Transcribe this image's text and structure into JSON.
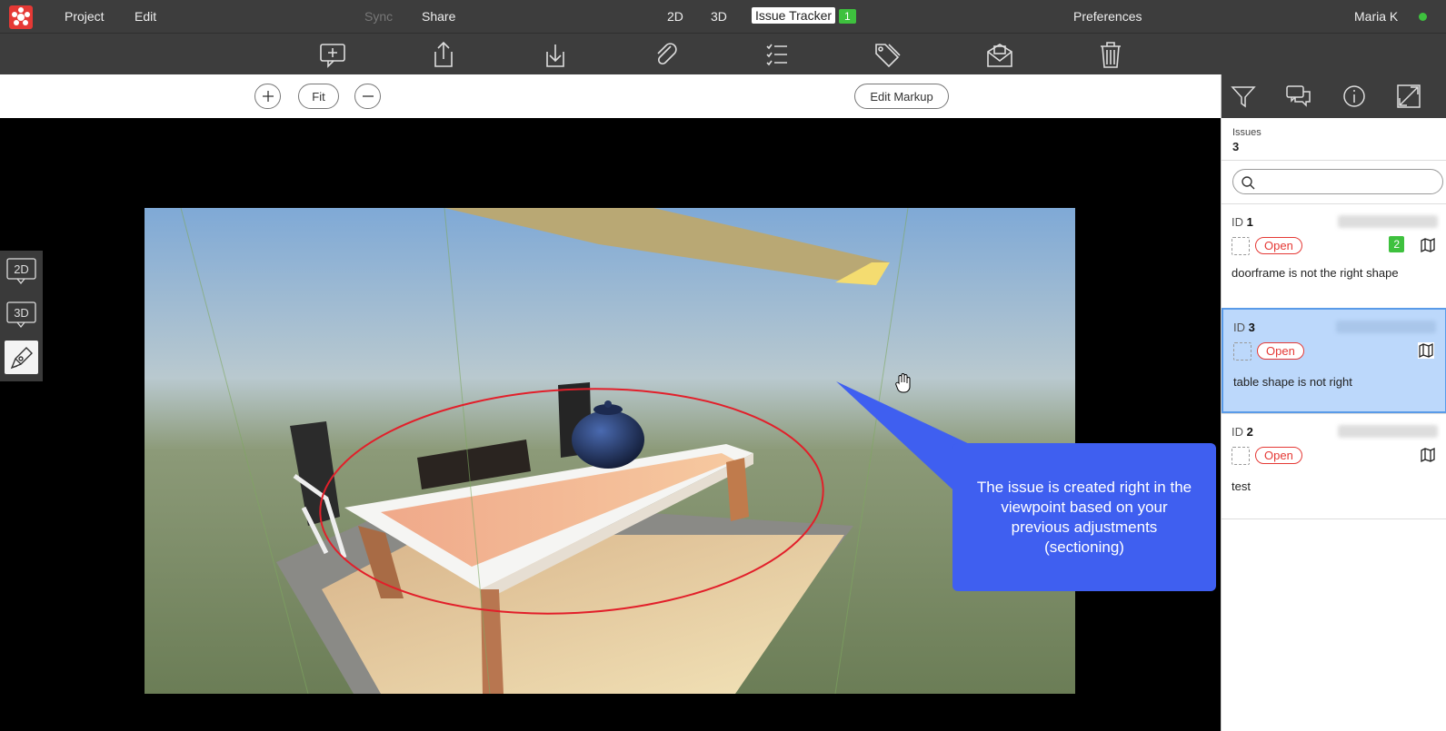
{
  "menubar": {
    "project": "Project",
    "edit": "Edit",
    "sync": "Sync",
    "share": "Share",
    "view_2d": "2D",
    "view_3d": "3D",
    "issue_tracker": "Issue Tracker",
    "issue_tracker_badge": "1",
    "preferences": "Preferences",
    "user": "Maria K",
    "user_status_color": "#3ec13e"
  },
  "toolbar": {
    "icons": [
      "add-comment-icon",
      "upload-icon",
      "download-icon",
      "attachment-icon",
      "checklist-icon",
      "tags-icon",
      "inbox-icon",
      "trash-icon"
    ]
  },
  "zoom": {
    "fit_label": "Fit",
    "edit_markup_label": "Edit Markup"
  },
  "sidebar_left": {
    "btn_2d": "2D",
    "btn_3d": "3D"
  },
  "callout": {
    "text": "The issue is created right in the viewpoint based on your previous adjustments (sectioning)"
  },
  "issues_panel": {
    "title": "Issues",
    "count": "3",
    "search_placeholder": "",
    "items": [
      {
        "id_label": "ID",
        "id": "1",
        "status": "Open",
        "comment_count": "2",
        "description": "doorframe is not the right shape",
        "selected": false
      },
      {
        "id_label": "ID",
        "id": "3",
        "status": "Open",
        "comment_count": "",
        "description": "table shape is not right",
        "selected": true
      },
      {
        "id_label": "ID",
        "id": "2",
        "status": "Open",
        "comment_count": "",
        "description": "test",
        "selected": false
      }
    ]
  },
  "colors": {
    "accent": "#3f5ff0",
    "status_open": "#e53935",
    "badge_green": "#3ec13e",
    "selected_row": "#bcd8fb"
  }
}
